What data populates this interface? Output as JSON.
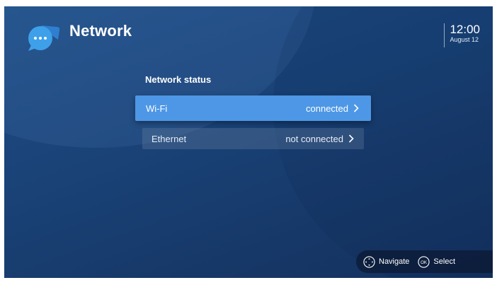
{
  "header": {
    "title": "Network",
    "app_icon": "chat-bubble-icon"
  },
  "clock": {
    "time": "12:00",
    "date": "August 12"
  },
  "network": {
    "section_title": "Network status",
    "items": [
      {
        "label": "Wi-Fi",
        "status": "connected",
        "selected": true
      },
      {
        "label": "Ethernet",
        "status": "not connected",
        "selected": false
      }
    ]
  },
  "hints": {
    "navigate_label": "Navigate",
    "select_label": "Select",
    "navigate_icon": "dpad-icon",
    "select_icon": "ok-button-icon",
    "select_icon_text": "OK"
  },
  "colors": {
    "background": "#1a4378",
    "selected_row": "#4d97e6",
    "app_icon": "#3fa0ea"
  }
}
